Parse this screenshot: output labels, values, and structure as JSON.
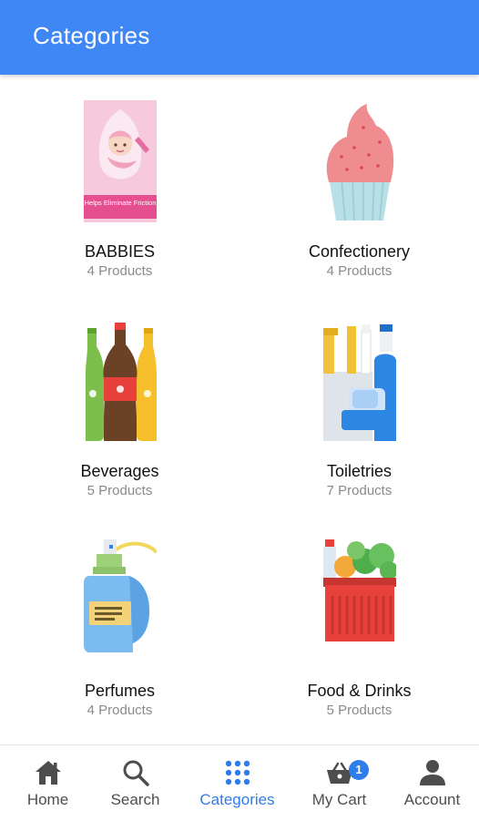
{
  "appbar": {
    "title": "Categories",
    "color": "#3f87f5"
  },
  "categories": [
    {
      "name": "BABBIES",
      "count": "4 Products",
      "image_text": "Helps Eliminate Friction",
      "icon": "baby-product-image"
    },
    {
      "name": "Confectionery",
      "count": "4 Products",
      "icon": "cupcake-image"
    },
    {
      "name": "Beverages",
      "count": "5 Products",
      "icon": "bottles-image"
    },
    {
      "name": "Toiletries",
      "count": "7 Products",
      "icon": "toiletries-image"
    },
    {
      "name": "Perfumes",
      "count": "4 Products",
      "icon": "perfume-spray-image"
    },
    {
      "name": "Food & Drinks",
      "count": "5 Products",
      "icon": "grocery-basket-image"
    }
  ],
  "bottom_nav": {
    "active": "Categories",
    "active_color": "#2f7de8",
    "items": [
      {
        "label": "Home",
        "icon": "home-icon"
      },
      {
        "label": "Search",
        "icon": "search-icon"
      },
      {
        "label": "Categories",
        "icon": "grid-dots-icon"
      },
      {
        "label": "My Cart",
        "icon": "cart-icon",
        "badge": "1"
      },
      {
        "label": "Account",
        "icon": "person-icon"
      }
    ]
  }
}
